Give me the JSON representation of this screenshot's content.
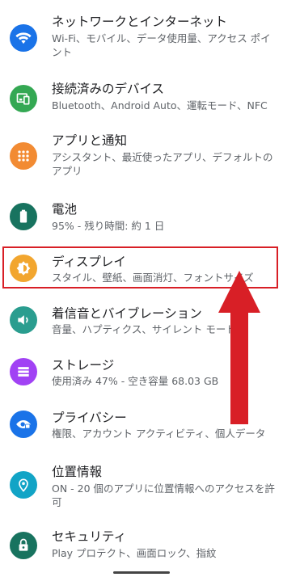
{
  "items": [
    {
      "title": "ネットワークとインターネット",
      "subtitle": "Wi-Fi、モバイル、データ使用量、アクセス ポイント",
      "icon": "wifi-icon",
      "color": "#1a73e8"
    },
    {
      "title": "接続済みのデバイス",
      "subtitle": "Bluetooth、Android Auto、運転モード、NFC",
      "icon": "devices-icon",
      "color": "#34a853"
    },
    {
      "title": "アプリと通知",
      "subtitle": "アシスタント、最近使ったアプリ、デフォルトのアプリ",
      "icon": "apps-icon",
      "color": "#f28b33"
    },
    {
      "title": "電池",
      "subtitle": "95% - 残り時間: 約 1 日",
      "icon": "battery-icon",
      "color": "#18735f"
    },
    {
      "title": "ディスプレイ",
      "subtitle": "スタイル、壁紙、画面消灯、フォントサイズ",
      "icon": "brightness-icon",
      "color": "#f2a62f"
    },
    {
      "title": "着信音とバイブレーション",
      "subtitle": "音量、ハプティクス、サイレント モード",
      "icon": "volume-icon",
      "color": "#2a9d8f"
    },
    {
      "title": "ストレージ",
      "subtitle": "使用済み 47% - 空き容量 68.03 GB",
      "icon": "storage-icon",
      "color": "#a142f4"
    },
    {
      "title": "プライバシー",
      "subtitle": "権限、アカウント アクティビティ、個人データ",
      "icon": "privacy-icon",
      "color": "#1a73e8"
    },
    {
      "title": "位置情報",
      "subtitle": "ON - 20 個のアプリに位置情報へのアクセスを許可",
      "icon": "location-icon",
      "color": "#12a4c6"
    },
    {
      "title": "セキュリティ",
      "subtitle": "Play プロテクト、画面ロック、指紋",
      "icon": "lock-icon",
      "color": "#18735f"
    }
  ],
  "colors": {
    "highlight": "#d81f26",
    "arrow": "#d81f26"
  }
}
